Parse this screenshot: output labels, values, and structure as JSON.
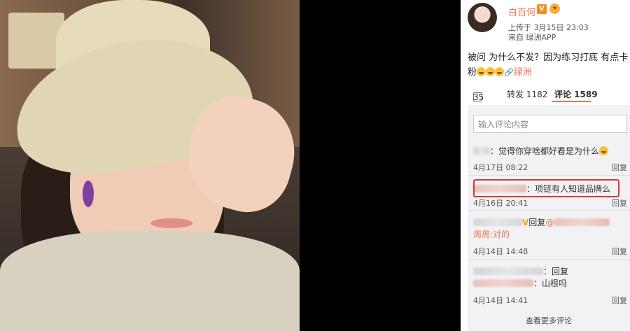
{
  "post": {
    "username": "白百何",
    "v_badge": "V",
    "uploaded": "上传于 3月15日 23:03",
    "source": "来自 绿洲APP",
    "text_line1": "被问 为什么不发？因为练习打底 有点卡",
    "text_line2": "粉",
    "link_text": "绿洲",
    "likes": "35",
    "reposts_label": "转发 1182",
    "comments_label": "评论 1589",
    "input_placeholder": "输入评论内容",
    "comments": [
      {
        "text": "：觉得你穿啥都好看是为什么",
        "time": "4月17日 08:22",
        "reply": "回复"
      },
      {
        "text": "：项链有人知道品牌么",
        "time": "4月16日 20:41",
        "reply": "回复"
      },
      {
        "text": "回复",
        "at": "@",
        "sub": "周周:对的",
        "time": "4月14日 14:48",
        "reply": "回复"
      },
      {
        "text": "：回复",
        "sub": "：山根吗",
        "time": "4月14日 14:41",
        "reply": "回复"
      }
    ],
    "more_label": "查看更多评论"
  },
  "colors": {
    "accent": "#eb7350",
    "highlight": "#d53a30",
    "badge": "#f78b1e"
  }
}
